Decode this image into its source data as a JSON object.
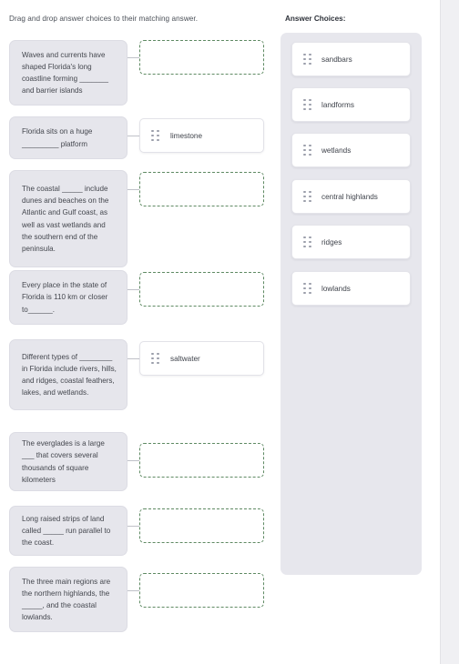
{
  "instruction": "Drag and drop answer choices to their matching answer.",
  "answer_panel": {
    "header": "Answer Choices:",
    "choices": [
      {
        "label": "sandbars",
        "handle": "drag-handle-icon"
      },
      {
        "label": "landforms",
        "handle": "drag-handle-icon"
      },
      {
        "label": "wetlands",
        "handle": "drag-handle-icon"
      },
      {
        "label": "central highlands",
        "handle": "drag-handle-icon"
      },
      {
        "label": "ridges",
        "handle": "drag-handle-icon"
      },
      {
        "label": "lowlands",
        "handle": "drag-handle-icon"
      }
    ]
  },
  "colors": {
    "question_box_bg": "#e6e6ec",
    "panel_bg": "#e7e7ed",
    "empty_slot_border": "#5f8a63",
    "card_bg": "#ffffff",
    "text": "#44474e"
  },
  "items": [
    {
      "question": "Waves and currents have shaped Florida's long coastline forming _______ and barrier islands",
      "slot": {
        "state": "empty",
        "label": ""
      }
    },
    {
      "question": "Florida sits on a huge _________ platform",
      "slot": {
        "state": "filled",
        "label": "limestone"
      }
    },
    {
      "question": "The coastal _____ include dunes and beaches on the Atlantic and Gulf coast, as well as vast wetlands and the southern end of the peninsula.",
      "slot": {
        "state": "empty",
        "label": ""
      }
    },
    {
      "question": "Every place in the state of Florida is 110 km or closer to______.",
      "slot": {
        "state": "empty",
        "label": ""
      }
    },
    {
      "question": "Different types of ________ in Florida include rivers, hills, and ridges, coastal feathers, lakes, and wetlands.",
      "slot": {
        "state": "filled",
        "label": "saltwater"
      }
    },
    {
      "question": "The everglades is a large ___ that covers several thousands of square kilometers",
      "slot": {
        "state": "empty",
        "label": ""
      }
    },
    {
      "question": "Long raised strips of land called _____ run parallel to the coast.",
      "slot": {
        "state": "empty",
        "label": ""
      }
    },
    {
      "question": "The three main regions are the northern highlands, the _____, and the coastal lowlands.",
      "slot": {
        "state": "empty",
        "label": ""
      }
    }
  ]
}
